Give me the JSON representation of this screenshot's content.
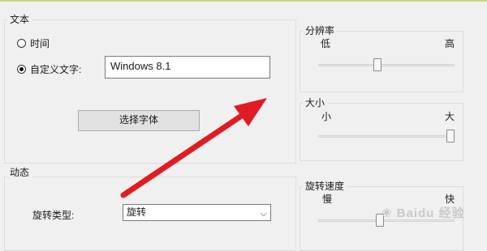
{
  "text_section": {
    "title": "文本",
    "radio_time_label": "时间",
    "radio_custom_label": "自定义文字:",
    "custom_text_value": "Windows 8.1",
    "choose_font_button": "选择字体"
  },
  "resolution": {
    "title": "分辨率",
    "low_label": "低",
    "high_label": "高",
    "level": 0.43
  },
  "size": {
    "title": "大小",
    "small_label": "小",
    "large_label": "大",
    "level": 1.0
  },
  "motion_section": {
    "title": "动态",
    "rotation_type_label": "旋转类型:",
    "rotation_type_value": "旋转"
  },
  "speed": {
    "title": "旋转速度",
    "slow_label": "慢",
    "fast_label": "快",
    "level": 0.45
  },
  "watermark": {
    "text": "Baidu 经验"
  },
  "colors": {
    "arrow": "#e11b22",
    "topline": "#c8d67a"
  }
}
